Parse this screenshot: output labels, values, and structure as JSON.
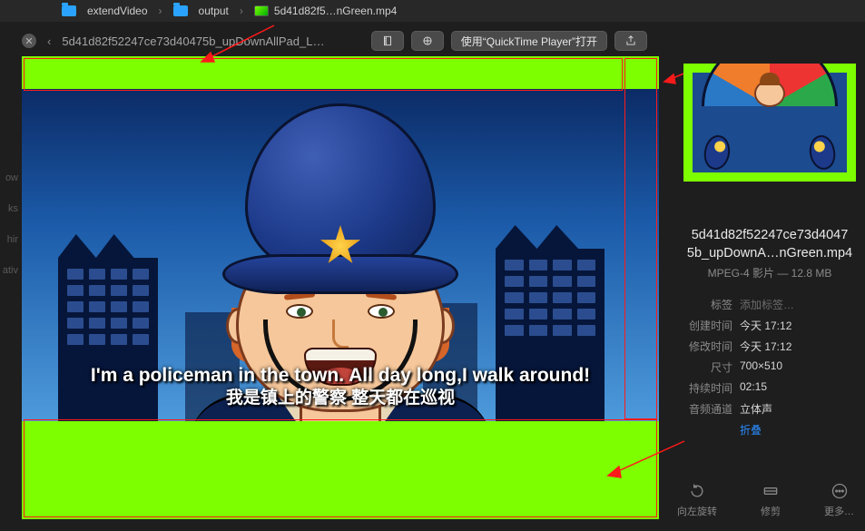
{
  "path": {
    "segments": [
      {
        "kind": "folder",
        "label": "extendVideo"
      },
      {
        "kind": "folder",
        "label": "output"
      },
      {
        "kind": "file",
        "label": "5d41d82f5…nGreen.mp4"
      }
    ]
  },
  "titlebar": {
    "doc_title": "5d41d82f52247ce73d40475b_upDownAllPad_L…",
    "open_with": "使用“QuickTime Player”打开"
  },
  "sidebar_items": [
    "ow",
    "ks",
    "hir",
    "ativ"
  ],
  "subtitle": {
    "en": "I'm a policeman in the town. All day long,I walk around!",
    "zh": "我是镇上的警察  整天都在巡视"
  },
  "info": {
    "filename_line1": "5d41d82f52247ce73d4047",
    "filename_line2": "5b_upDownA…nGreen.mp4",
    "type_and_size": "MPEG-4 影片 — 12.8 MB",
    "labels": {
      "tags": "标签",
      "created": "创建时间",
      "modified": "修改时间",
      "dimensions": "尺寸",
      "duration": "持续时间",
      "audio": "音频通道"
    },
    "values": {
      "tags": "添加标签…",
      "created": "今天 17:12",
      "modified": "今天 17:12",
      "dimensions": "700×510",
      "duration": "02:15",
      "audio": "立体声",
      "collapse": "折叠"
    }
  },
  "actions": {
    "rotate_left": "向左旋转",
    "trim": "修剪",
    "more": "更多…"
  }
}
